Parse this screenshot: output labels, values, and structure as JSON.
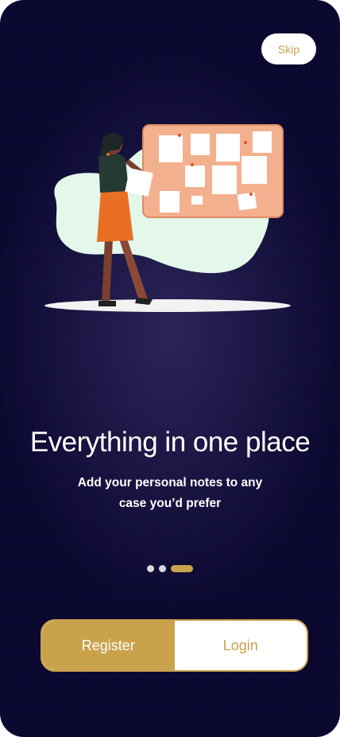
{
  "header": {
    "skip_label": "Skip"
  },
  "onboarding": {
    "title": "Everything in one place",
    "subtitle": "Add your personal notes to any case you’d prefer",
    "page_indicator": {
      "total": 3,
      "active": 3
    }
  },
  "auth": {
    "register_label": "Register",
    "login_label": "Login"
  },
  "colors": {
    "background": "#0b0831",
    "accent": "#c9a24b",
    "board": "#f2b08e",
    "blob": "#e3f7ea"
  },
  "icons": [
    "woman-with-notes-illustration",
    "corkboard-icon"
  ]
}
